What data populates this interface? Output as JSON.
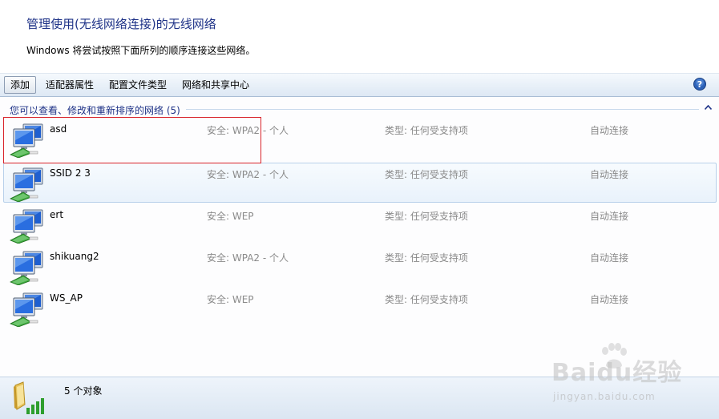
{
  "header": {
    "title": "管理使用(无线网络连接)的无线网络",
    "subtitle": "Windows 将尝试按照下面所列的顺序连接这些网络。"
  },
  "toolbar": {
    "add_label": "添加",
    "adapter_props_label": "适配器属性",
    "profile_type_label": "配置文件类型",
    "sharing_center_label": "网络和共享中心",
    "help_icon": "help-icon"
  },
  "group": {
    "header": "您可以查看、修改和重新排序的网络 (5)"
  },
  "networks": [
    {
      "name": "asd",
      "security": "安全: WPA2 - 个人",
      "type": "类型: 任何受支持项",
      "mode": "自动连接"
    },
    {
      "name": "SSID 2 3",
      "security": "安全: WPA2 - 个人",
      "type": "类型: 任何受支持项",
      "mode": "自动连接"
    },
    {
      "name": "ert",
      "security": "安全: WEP",
      "type": "类型: 任何受支持项",
      "mode": "自动连接"
    },
    {
      "name": "shikuang2",
      "security": "安全: WPA2 - 个人",
      "type": "类型: 任何受支持项",
      "mode": "自动连接"
    },
    {
      "name": "WS_AP",
      "security": "安全: WEP",
      "type": "类型: 任何受支持项",
      "mode": "自动连接"
    }
  ],
  "status": {
    "count_text": "5 个对象"
  },
  "watermark": {
    "brand": "Baidu经验",
    "url": "jingyan.baidu.com"
  },
  "colors": {
    "title": "#1e3287",
    "highlight": "#d8232a",
    "hover_border": "#b8d0ea",
    "signal_green": "#2e9e2e"
  }
}
